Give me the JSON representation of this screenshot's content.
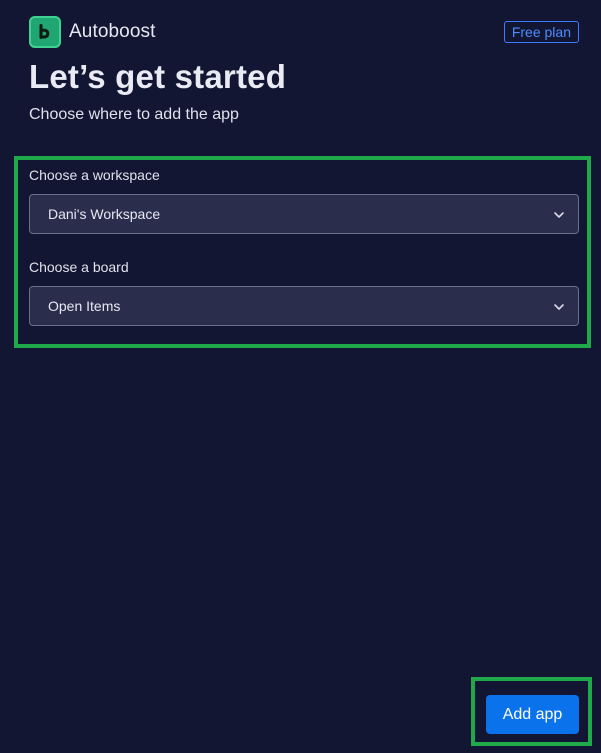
{
  "header": {
    "logo_icon": "brand-logo-icon",
    "app_name": "Autoboost",
    "plan_badge": "Free plan"
  },
  "intro": {
    "title": "Let’s get started",
    "subtitle": "Choose where to add the app"
  },
  "form": {
    "workspace": {
      "label": "Choose a workspace",
      "selected": "Dani's Workspace",
      "icon": "chevron-down-icon"
    },
    "board": {
      "label": "Choose a board",
      "selected": "Open Items",
      "icon": "chevron-down-icon"
    }
  },
  "actions": {
    "add_label": "Add app"
  },
  "colors": {
    "background": "#121632",
    "accent_blue": "#0a73eb",
    "highlight_green": "#1fa94b",
    "logo_green": "#1fa672",
    "select_bg": "#2b2d4d"
  }
}
